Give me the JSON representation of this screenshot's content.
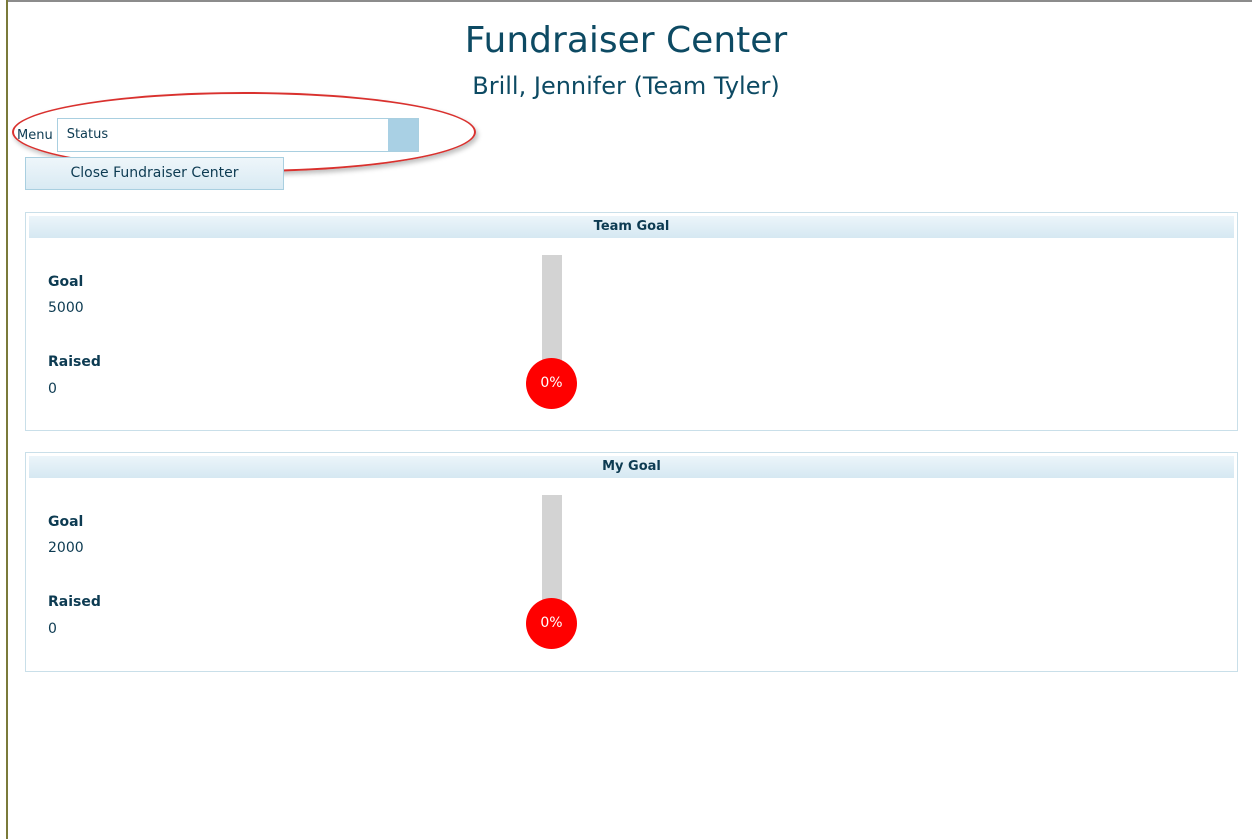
{
  "header": {
    "title": "Fundraiser Center",
    "subtitle": "Brill, Jennifer (Team Tyler)"
  },
  "menu": {
    "label": "Menu",
    "selected": "Status",
    "icon": "dropdown-arrow-icon"
  },
  "close_button_label": "Close Fundraiser Center",
  "panels": [
    {
      "title": "Team Goal",
      "goal_label": "Goal",
      "goal_value": "5000",
      "raised_label": "Raised",
      "raised_value": "0",
      "percent_label": "0%",
      "progress": 0
    },
    {
      "title": "My Goal",
      "goal_label": "Goal",
      "goal_value": "2000",
      "raised_label": "Raised",
      "raised_value": "0",
      "percent_label": "0%",
      "progress": 0
    }
  ],
  "colors": {
    "title": "#0d4a63",
    "thermometer_fill": "#ff0000",
    "thermometer_tube": "#d3d3d3",
    "highlight": "#d9312e"
  }
}
